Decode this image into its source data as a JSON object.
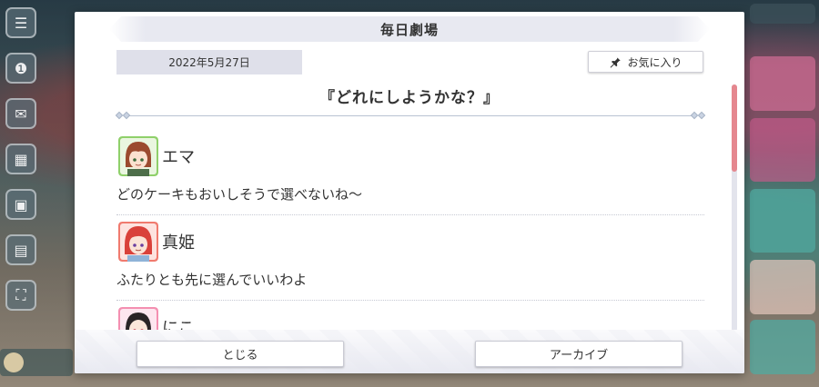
{
  "dialog": {
    "title": "毎日劇場",
    "date": "2022年5月27日",
    "favorite_label": "お気に入り",
    "theater_title": "『どれにしようかな？』"
  },
  "entries": [
    {
      "speaker": "エマ",
      "line": "どのケーキもおいしそうで選べないね〜",
      "avatar_color": "#8fd06a"
    },
    {
      "speaker": "真姫",
      "line": "ふたりとも先に選んでいいわよ",
      "avatar_color": "#f07a6e"
    },
    {
      "speaker": "にこ",
      "line": "",
      "avatar_color": "#f48fb1"
    }
  ],
  "buttons": {
    "close_label": "とじる",
    "archive_label": "アーカイブ"
  },
  "colors": {
    "accent": "#e5878f",
    "banner": "#e8e9f1",
    "date_bg": "#dfe0ea"
  }
}
